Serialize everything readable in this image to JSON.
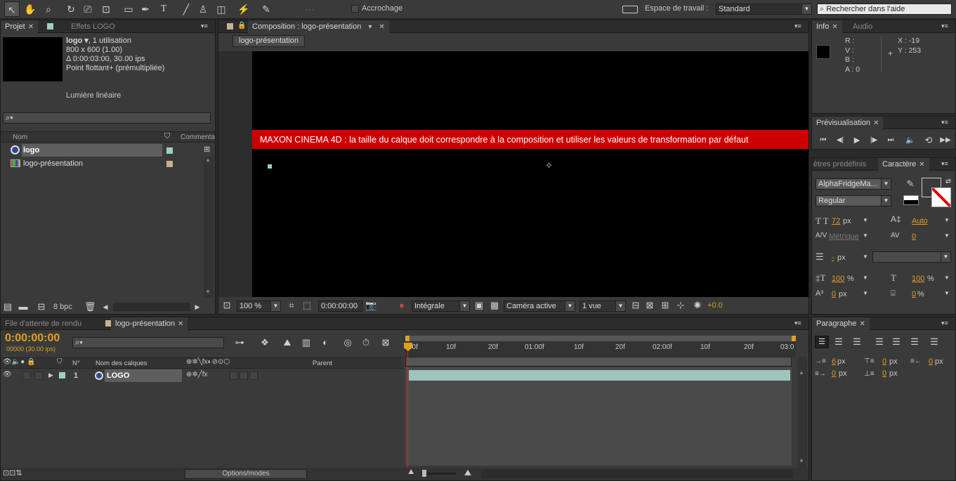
{
  "toolbar": {
    "snapping_label": "Accrochage",
    "workspace_label": "Espace de travail :",
    "workspace_value": "Standard",
    "help_search_placeholder": "Rechercher dans l'aide"
  },
  "project_panel": {
    "tabs": [
      "Projet",
      "Effets LOGO"
    ],
    "item_name": "logo ▾",
    "item_usage": ", 1 utilisation",
    "item_size": "800 x 600 (1.00)",
    "item_duration": "Δ 0:00:03:00, 30.00 ips",
    "item_depth": "Point flottant+ (prémultipliée)",
    "item_light": "Lumière linéaire",
    "col_name": "Nom",
    "col_comment": "Commentai",
    "rows": [
      {
        "name": "logo",
        "selected": true,
        "swatch": "#9ad0c8"
      },
      {
        "name": "logo-présentation",
        "selected": false,
        "swatch": "#c8b090"
      }
    ],
    "bpc_label": "8 bpc"
  },
  "composition_panel": {
    "tab_label": "Composition : logo-présentation",
    "crumb": "logo-présentation",
    "warning": "MAXON CINEMA 4D : la taille du calque doit correspondre à la composition et utiliser les valeurs de transformation par défaut",
    "zoom": "100 %",
    "timecode": "0:00:00:00",
    "resolution": "Intégrale",
    "camera": "Caméra active",
    "views": "1 vue",
    "exposure": "+0.0"
  },
  "info_panel": {
    "tabs": [
      "Info",
      "Audio"
    ],
    "r_label": "R :",
    "v_label": "V :",
    "b_label": "B :",
    "a_label": "A :",
    "a_value": "0",
    "x_label": "X : -19",
    "y_label": "Y : 253"
  },
  "preview_panel": {
    "tab_label": "Prévisualisation"
  },
  "character_panel": {
    "tabs": [
      "ètres prédéfinis",
      "Caractère"
    ],
    "font_family": "AlphaFridgeMa...",
    "font_style": "Regular",
    "font_size": "72",
    "font_size_unit": "px",
    "leading": "Auto",
    "kerning": "Métrique",
    "tracking": "0",
    "stroke_width": "-",
    "stroke_unit": "px",
    "vscale": "100",
    "vscale_unit": "%",
    "hscale": "100",
    "hscale_unit": "%",
    "baseline": "0",
    "baseline_unit": "px",
    "tsume": "0",
    "tsume_unit": "%"
  },
  "paragraph_panel": {
    "tab_label": "Paragraphe",
    "indent_left": "6",
    "indent_top": "0",
    "indent_right": "0",
    "indent_first": "0",
    "space_after": "0",
    "unit": "px"
  },
  "timeline": {
    "tabs": [
      "File d'attente de rendu",
      "logo-présentation"
    ],
    "timecode": "0:00:00:00",
    "fps_label": "00000 (30.00 ips)",
    "col_num": "N°",
    "col_layer_name": "Nom des calques",
    "col_parent": "Parent",
    "layer_num": "1",
    "layer_name": "LOGO",
    "ruler": [
      "00f",
      "10f",
      "20f",
      "01:00f",
      "10f",
      "20f",
      "02:00f",
      "10f",
      "20f",
      "03:0"
    ],
    "options_label": "Options/modes"
  },
  "colors": {
    "accent": "#e0a020",
    "warning_bg": "#cc0000",
    "layer_bar": "#9ec4be",
    "panel_bg": "#3a3a3a"
  }
}
